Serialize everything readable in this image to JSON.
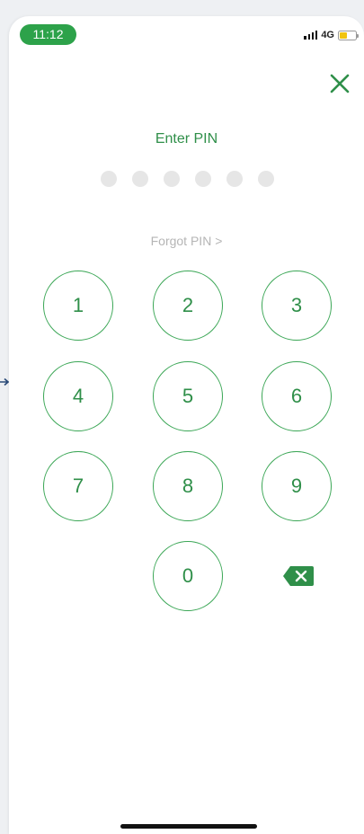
{
  "status_bar": {
    "time": "11:12",
    "network": "4G",
    "time_badge_color": "#2da24a",
    "battery_color": "#f1c40f"
  },
  "header": {
    "close_icon": "close-icon"
  },
  "pin": {
    "title": "Enter PIN",
    "length": 6,
    "entered": 0
  },
  "forgot_link": "Forgot PIN >",
  "keypad": {
    "keys": [
      "1",
      "2",
      "3",
      "4",
      "5",
      "6",
      "7",
      "8",
      "9",
      "0"
    ],
    "backspace_icon": "backspace-icon",
    "accent_color": "#2f8f49"
  }
}
